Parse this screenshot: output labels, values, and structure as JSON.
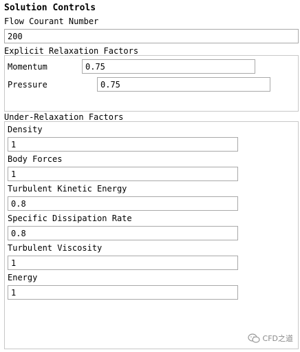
{
  "panel": {
    "title": "Solution Controls",
    "flow_courant": {
      "label": "Flow Courant Number",
      "value": "200"
    },
    "explicit_relaxation": {
      "title": "Explicit Relaxation Factors",
      "momentum": {
        "label": "Momentum",
        "value": "0.75"
      },
      "pressure": {
        "label": "Pressure",
        "value": "0.75"
      }
    },
    "under_relaxation": {
      "title": "Under-Relaxation Factors",
      "density": {
        "label": "Density",
        "value": "1"
      },
      "body_forces": {
        "label": "Body Forces",
        "value": "1"
      },
      "tke": {
        "label": "Turbulent Kinetic Energy",
        "value": "0.8"
      },
      "sdr": {
        "label": "Specific Dissipation Rate",
        "value": "0.8"
      },
      "turb_visc": {
        "label": "Turbulent Viscosity",
        "value": "1"
      },
      "energy": {
        "label": "Energy",
        "value": "1"
      }
    }
  },
  "watermark": {
    "text": "CFD之道",
    "icon": "wechat-icon"
  }
}
